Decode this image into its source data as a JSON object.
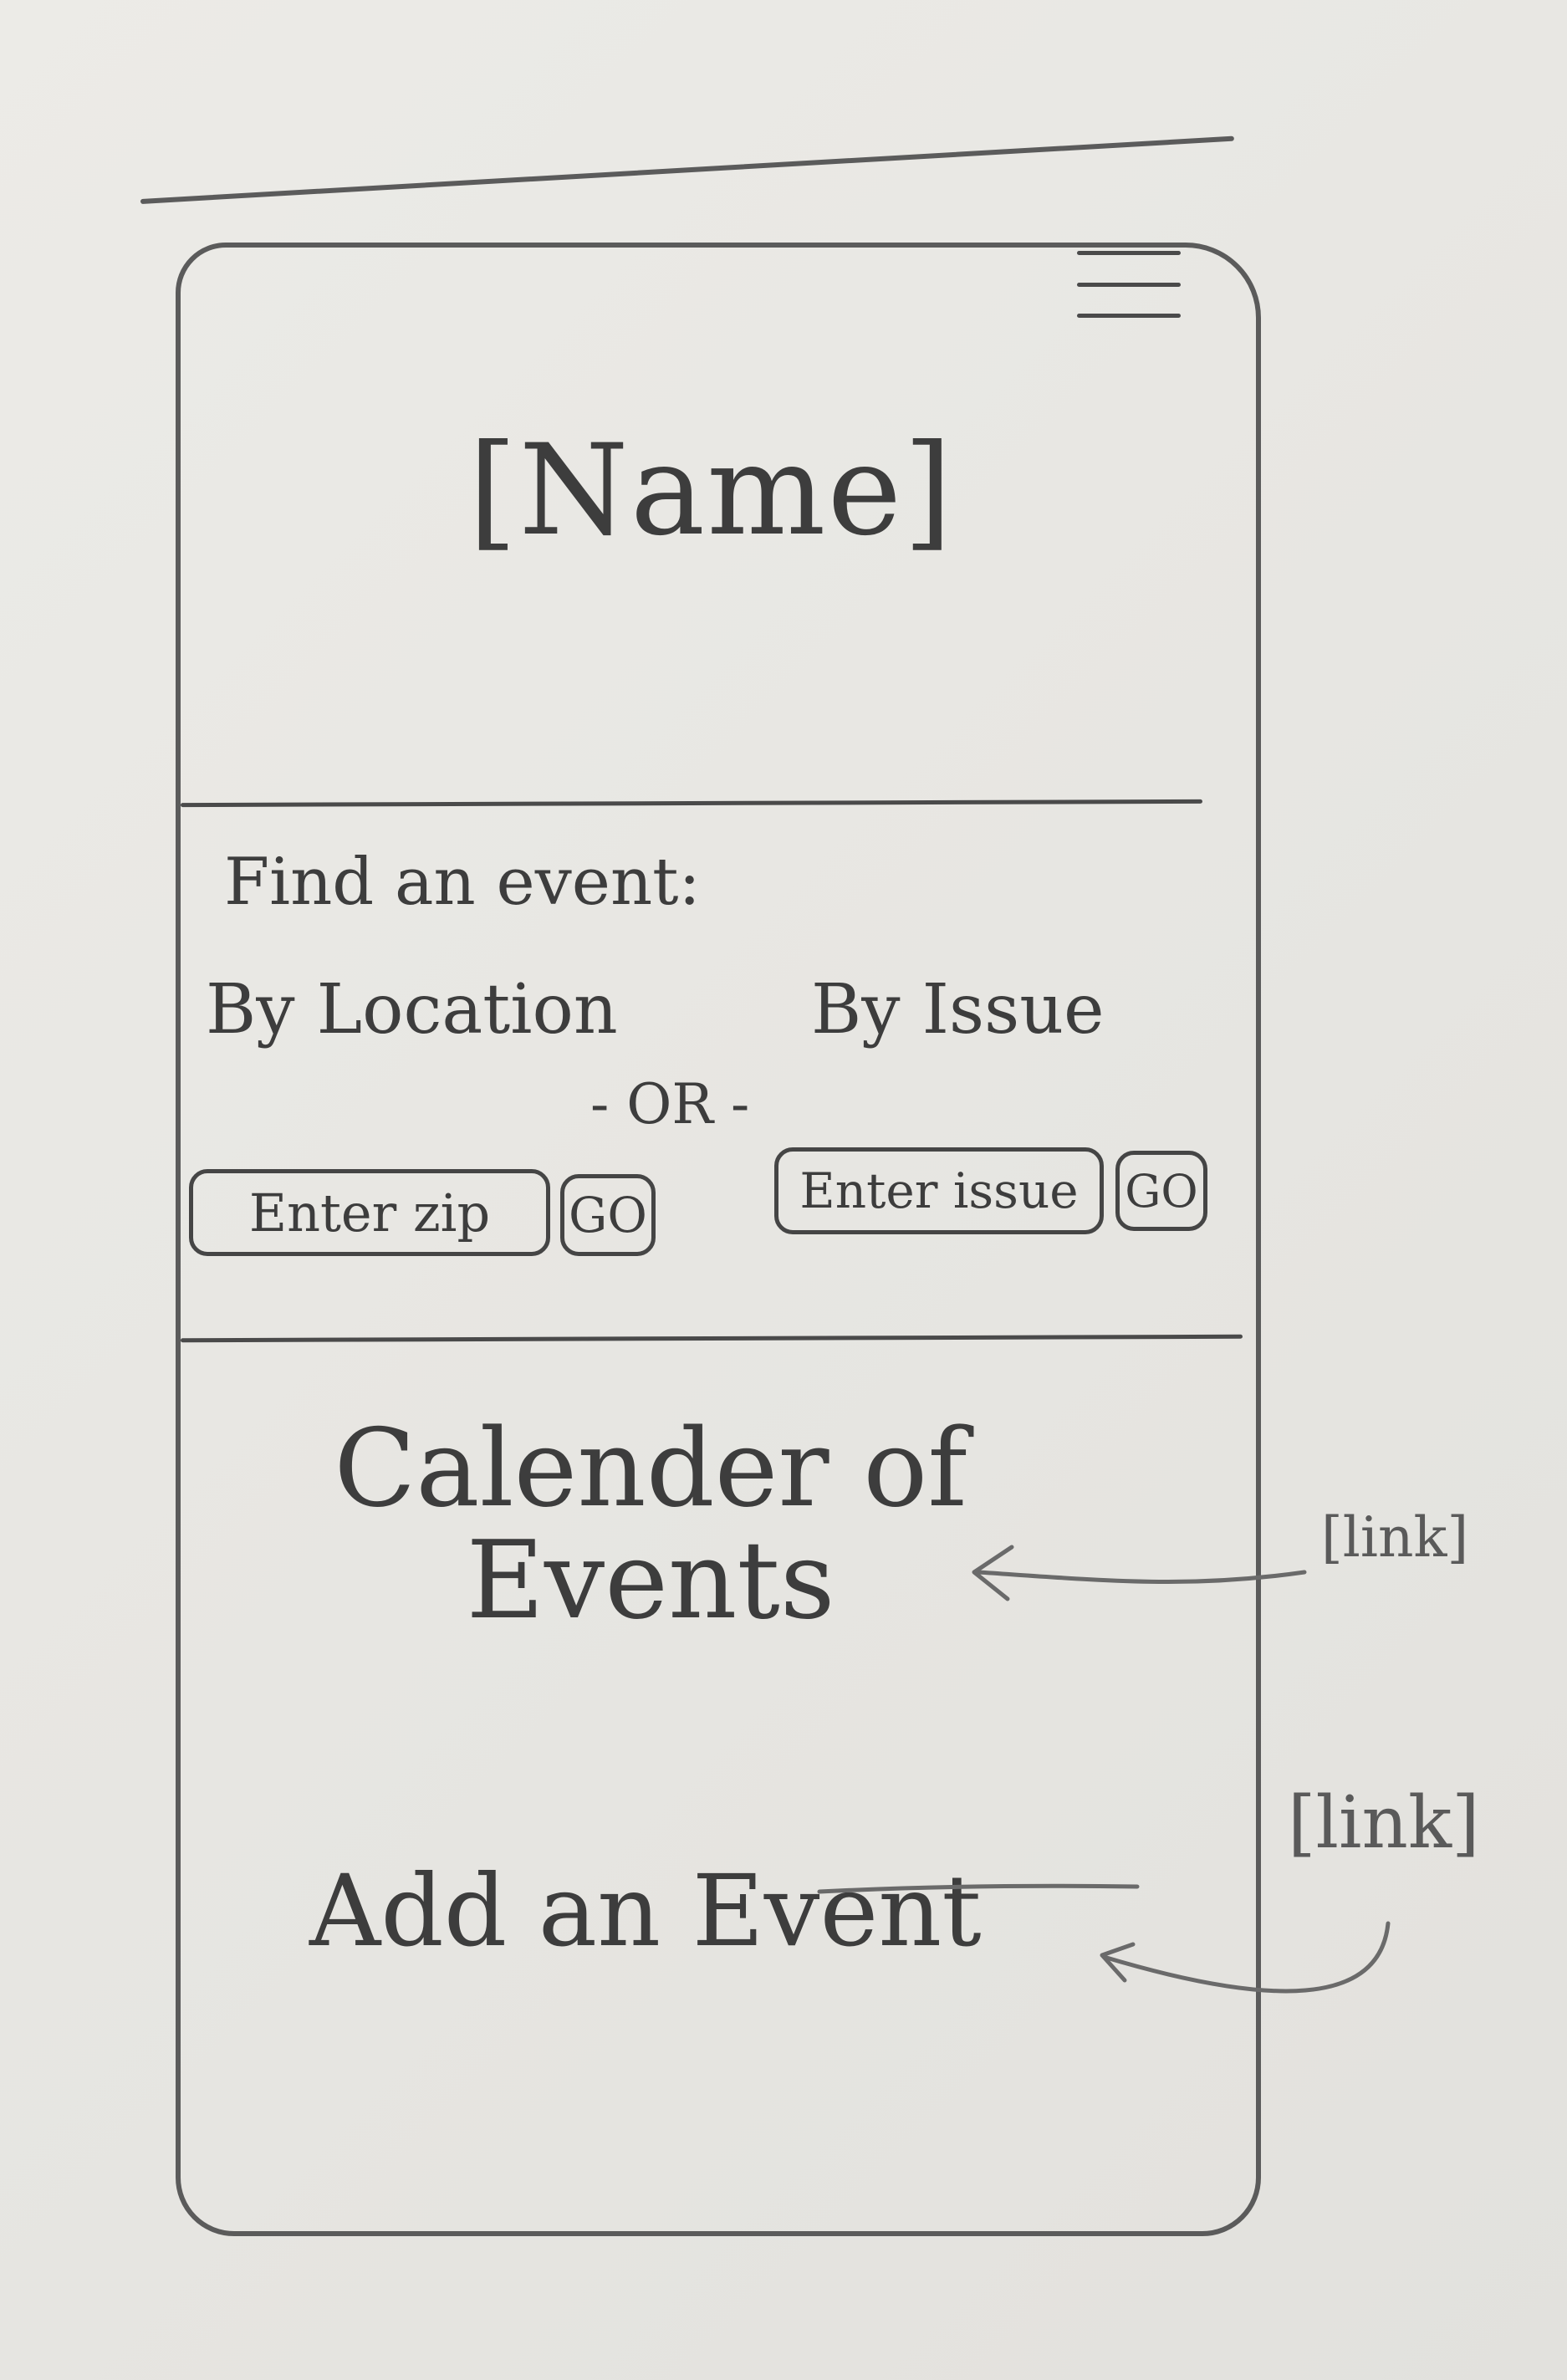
{
  "header": {
    "name": "[Name]",
    "menu_icon": "hamburger-menu-icon"
  },
  "search": {
    "title": "Find an event:",
    "by_location_label": "By Location",
    "by_issue_label": "By Issue",
    "or_label": "- OR -",
    "zip_placeholder": "Enter zip",
    "issue_placeholder": "Enter issue",
    "go_label": "GO"
  },
  "links": {
    "calendar_label": "Calender of Events",
    "add_event_label": "Add an Event"
  },
  "annotations": {
    "calendar_note": "[link]",
    "add_event_note": "[link]"
  }
}
